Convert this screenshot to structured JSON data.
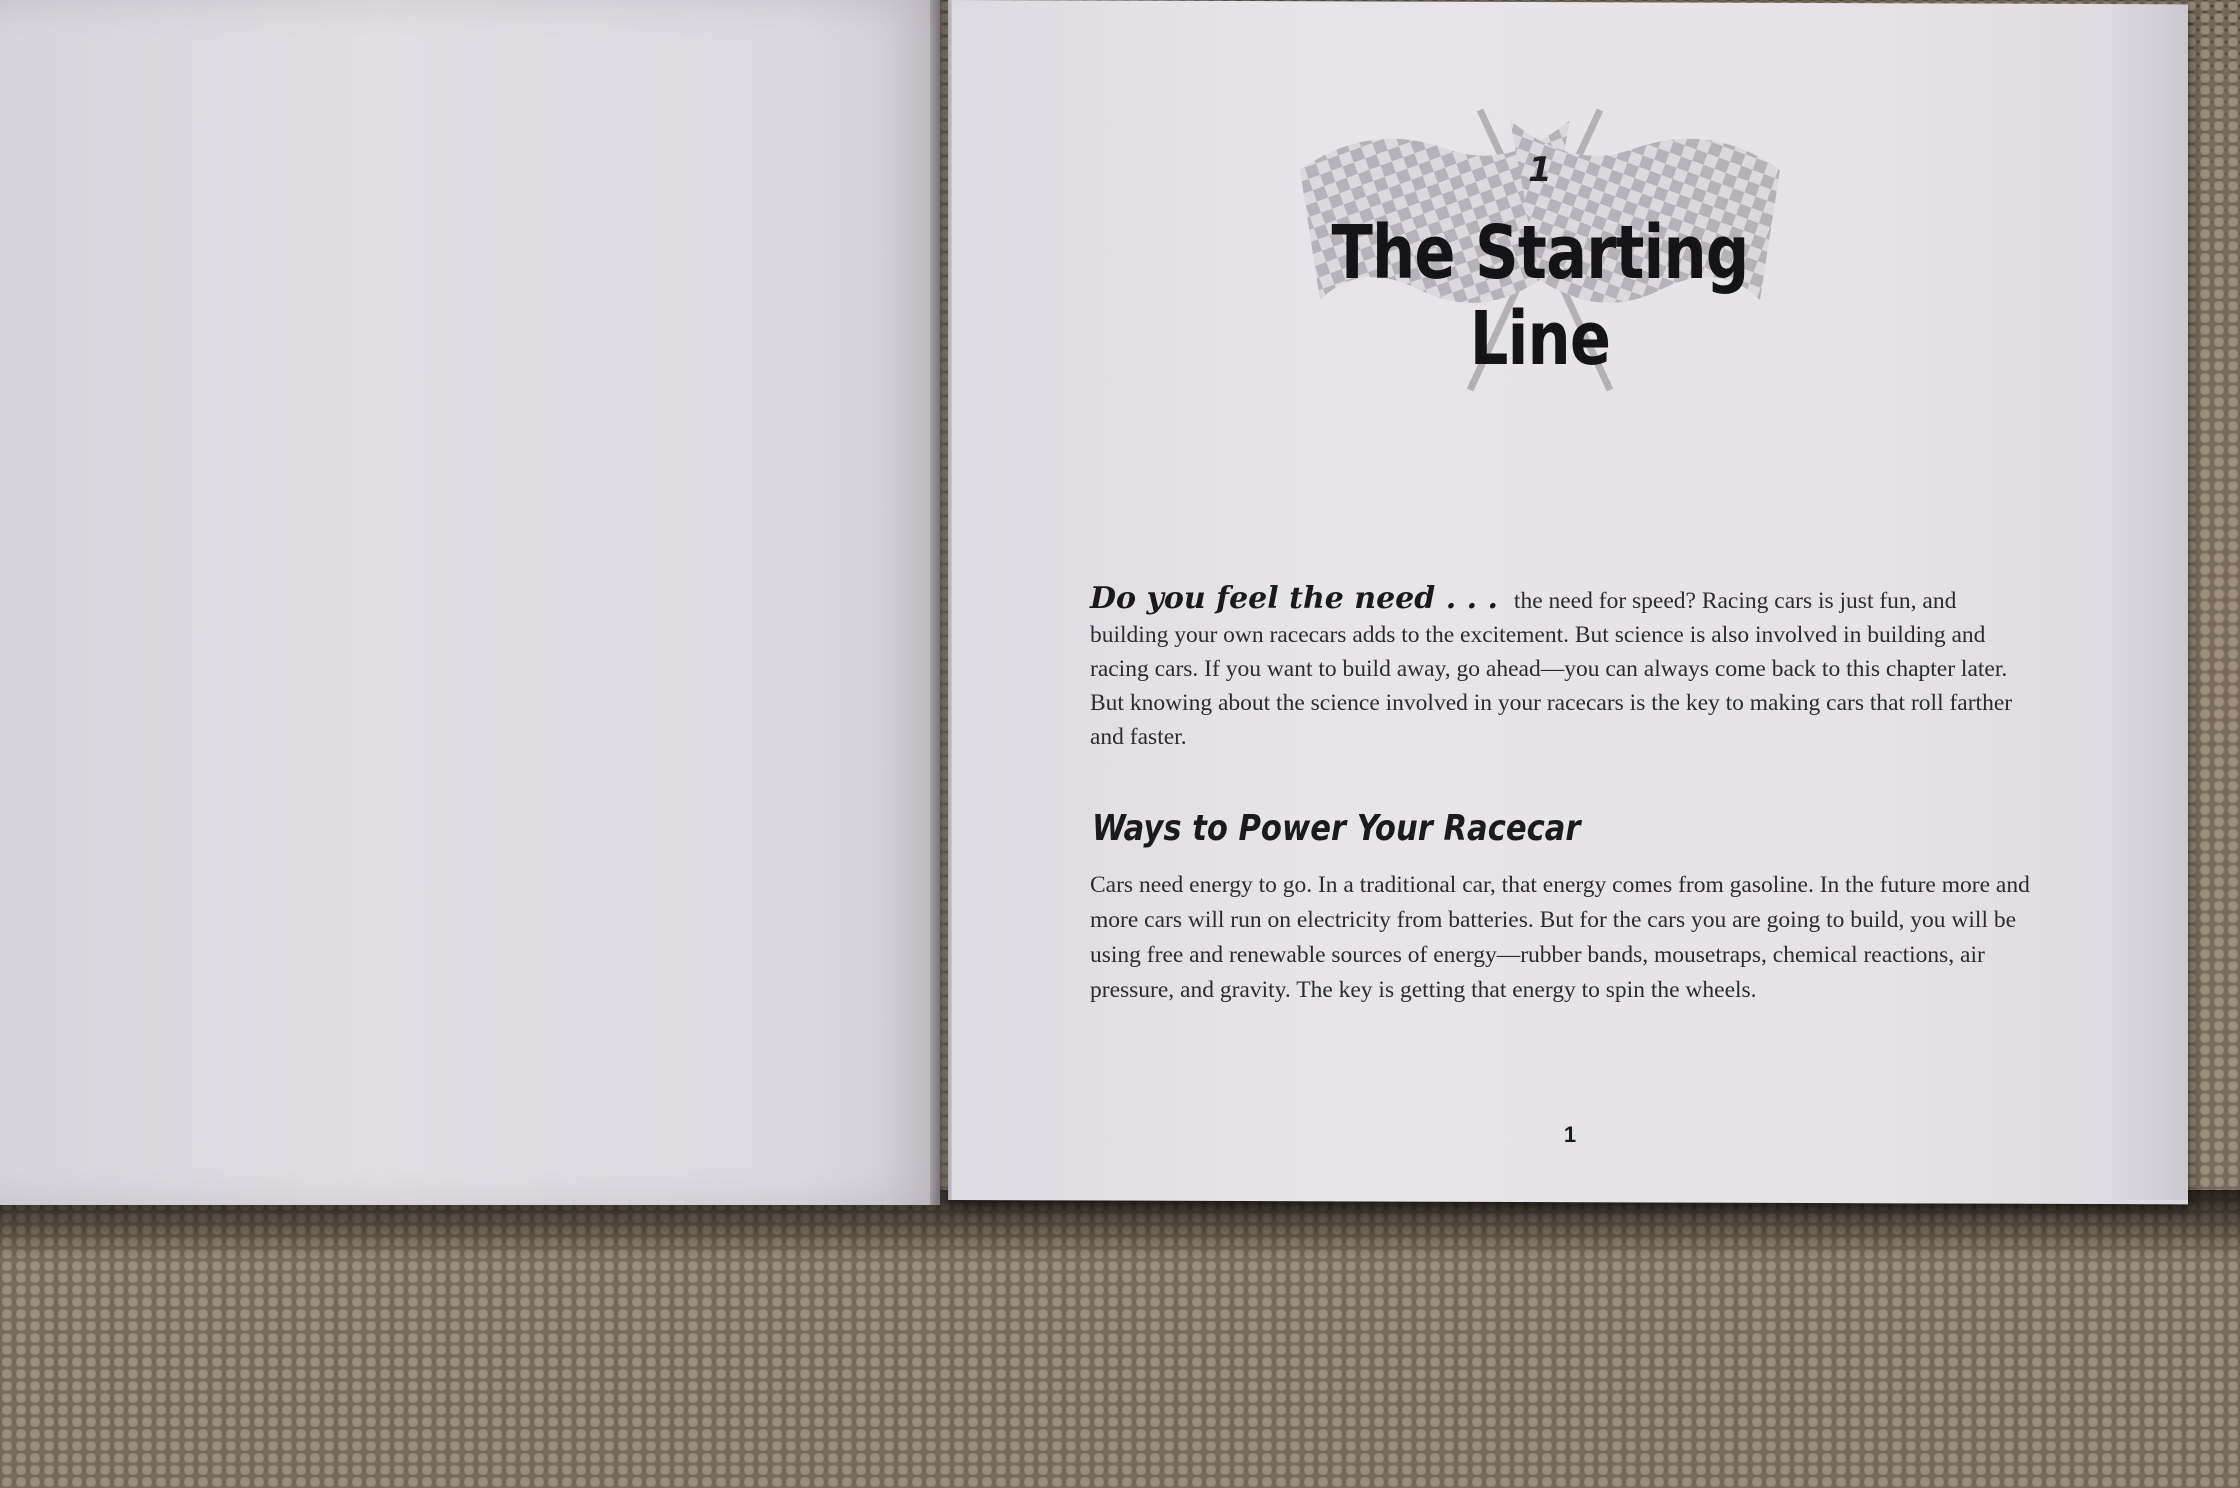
{
  "book": {
    "chapter_number": "1",
    "chapter_title": "The Starting Line",
    "intro_lead": "Do you feel the need . . .",
    "intro_text": "the need for speed? Racing cars is just fun, and building your own racecars adds to the excitement. But science is also involved in building and racing cars. If you want to build away, go ahead—you can always come back to this chapter later. But knowing about the science involved in your racecars is the key to making cars that roll farther and faster.",
    "section_heading": "Ways to Power Your Racecar",
    "section_text": "Cars need energy to go. In a traditional car, that energy comes from gasoline. In the future more and more cars will run on electricity from batteries. But for the cars you are going to build, you will be using free and renewable sources of energy—rubber bands, mousetraps, chemical reactions, air pressure, and gravity. The key is getting that energy to spin the wheels.",
    "page_number": "1"
  },
  "icons": {
    "decoration": "checkered-flags-icon"
  },
  "colors": {
    "paper": "#e8e5ea",
    "ink": "#1b1a1e",
    "carpet": "#6e6458"
  }
}
